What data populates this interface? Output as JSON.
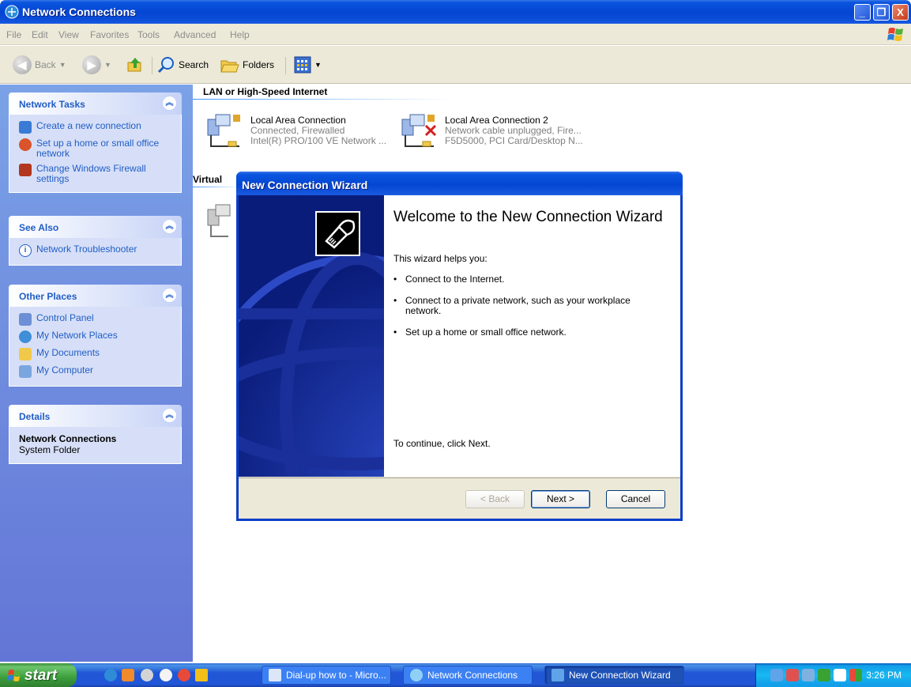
{
  "window": {
    "title": "Network Connections",
    "controls": {
      "minimize": "_",
      "maximize": "❐",
      "close": "X"
    }
  },
  "menu": [
    "File",
    "Edit",
    "View",
    "Favorites",
    "Tools",
    "Advanced",
    "Help"
  ],
  "toolbar": {
    "back": "Back",
    "search": "Search",
    "folders": "Folders"
  },
  "taskpane": {
    "network_tasks": {
      "title": "Network Tasks",
      "items": [
        "Create a new connection",
        "Set up a home or small office network",
        "Change Windows Firewall settings"
      ]
    },
    "see_also": {
      "title": "See Also",
      "items": [
        "Network Troubleshooter"
      ]
    },
    "other_places": {
      "title": "Other Places",
      "items": [
        "Control Panel",
        "My Network Places",
        "My Documents",
        "My Computer"
      ]
    },
    "details": {
      "title": "Details",
      "name": "Network Connections",
      "type": "System Folder"
    }
  },
  "content": {
    "group_lan": "LAN or High-Speed Internet",
    "group_virtual": "Virtual",
    "connections": [
      {
        "name": "Local Area Connection",
        "status": "Connected, Firewalled",
        "device": "Intel(R) PRO/100 VE Network ..."
      },
      {
        "name": "Local Area Connection 2",
        "status": "Network cable unplugged, Fire...",
        "device": "F5D5000, PCI Card/Desktop N..."
      }
    ]
  },
  "wizard": {
    "title": "New Connection Wizard",
    "heading": "Welcome to the New Connection Wizard",
    "intro": "This wizard helps you:",
    "bullets": [
      "Connect to the Internet.",
      "Connect to a private network, such as your workplace network.",
      "Set up a home or small office network."
    ],
    "continue_text": "To continue, click Next.",
    "buttons": {
      "back": "< Back",
      "next": "Next >",
      "cancel": "Cancel"
    }
  },
  "taskbar": {
    "start": "start",
    "tasks": [
      "Dial-up how to - Micro...",
      "Network Connections",
      "New Connection Wizard"
    ],
    "clock": "3:26 PM"
  },
  "colors": {
    "xp_blue": "#0446d2",
    "link_blue": "#215dc6",
    "taskpane_bg": "#6375d6",
    "start_green": "#3c9e3c"
  }
}
